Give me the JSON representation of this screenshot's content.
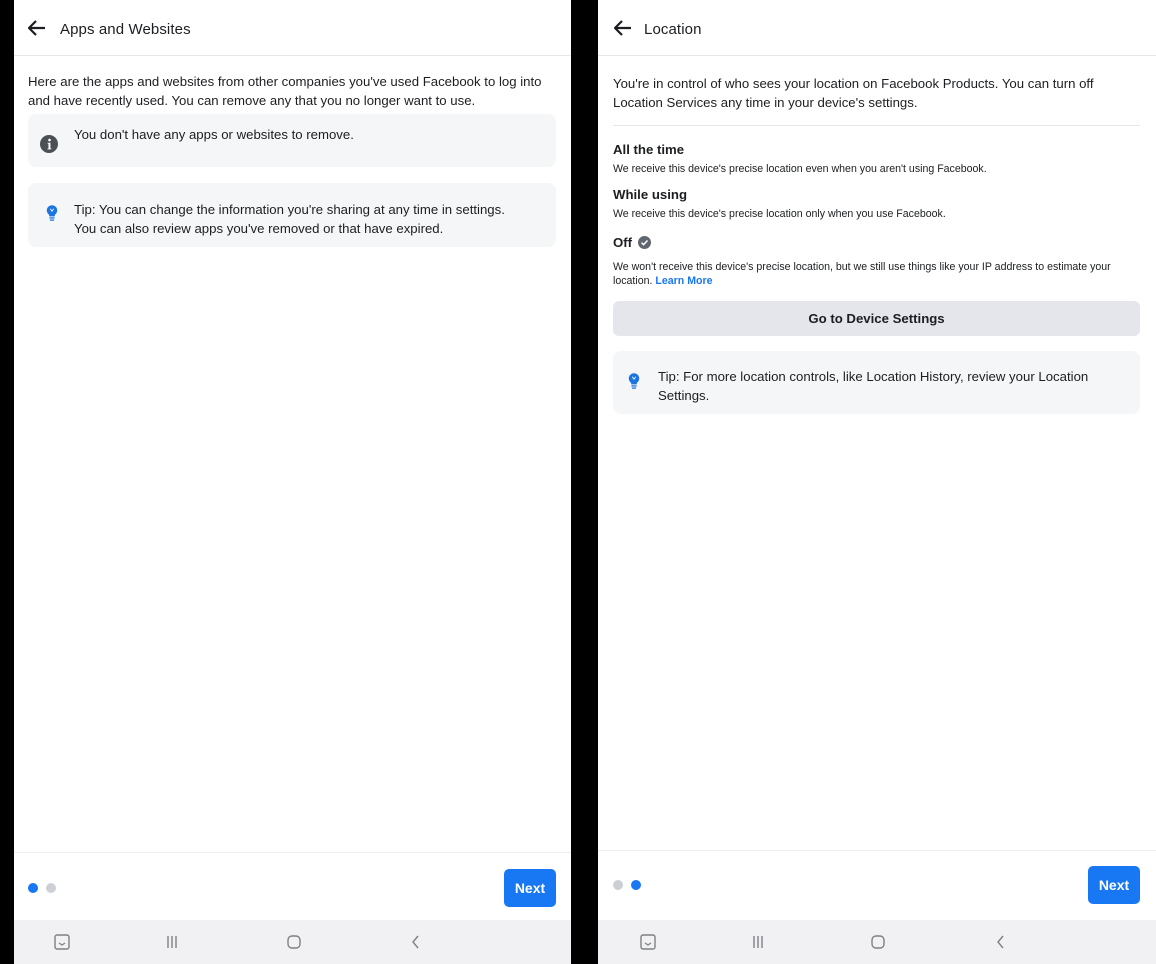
{
  "left_screen": {
    "header": {
      "title": "Apps and Websites",
      "back_icon": "arrow-left-icon"
    },
    "intro": "Here are the apps and websites from other companies you've used Facebook to log into and have recently used. You can remove any that you no longer want to use.",
    "info_card": {
      "icon": "info-icon",
      "text": "You don't have any apps or websites to remove."
    },
    "tip_card": {
      "icon": "lightbulb-icon",
      "text": "Tip: You can change the information you're sharing at any time in settings. You can also review apps you've removed or that have expired."
    },
    "pager": {
      "active_index": 0,
      "count": 2
    },
    "next_label": "Next"
  },
  "right_screen": {
    "header": {
      "title": "Location",
      "back_icon": "arrow-left-icon"
    },
    "intro": "You're in control of who sees your location on Facebook Products. You can turn off Location Services any time in your device's settings.",
    "options": [
      {
        "title": "All the time",
        "desc": "We receive this device's precise location even when you aren't using Facebook."
      },
      {
        "title": "While using",
        "desc": "We receive this device's precise location only when you use Facebook."
      },
      {
        "title": "Off",
        "selected": true,
        "desc": "We won't receive this device's precise location, but we still use things like your IP address to estimate your location.",
        "link": "Learn More"
      }
    ],
    "device_settings_label": "Go to Device Settings",
    "tip_card": {
      "icon": "lightbulb-icon",
      "text": "Tip: For more location controls, like Location History, review your Location Settings."
    },
    "pager": {
      "active_index": 1,
      "count": 2
    },
    "next_label": "Next"
  },
  "nav_bar": {
    "items": [
      "screenshot-icon",
      "recent-apps-icon",
      "home-icon",
      "back-icon"
    ]
  },
  "colors": {
    "accent": "#1877f2",
    "card_bg": "#f5f6f7",
    "button_gray": "#e4e6eb",
    "dot_inactive": "#ccd0d5",
    "tip_icon": "#1b74e4"
  }
}
